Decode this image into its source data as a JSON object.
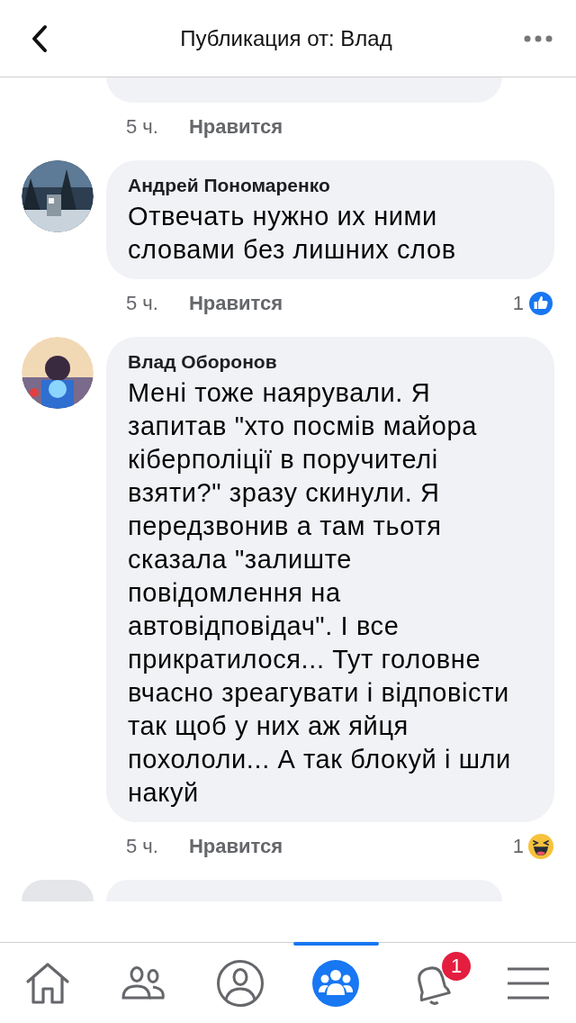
{
  "header": {
    "title": "Публикация от: Влад"
  },
  "comments": [
    {
      "kind": "partial",
      "time": "5 ч.",
      "like_label": "Нравится"
    },
    {
      "kind": "full",
      "author": "Андрей Пономаренко",
      "text": "Отвечать нужно их ними словами без лишних слов",
      "time": "5 ч.",
      "like_label": "Нравится",
      "reaction": {
        "count": "1",
        "kind": "like"
      }
    },
    {
      "kind": "full",
      "author": "Влад Оборонов",
      "text": "Мені тоже наярували. Я запитав \"хто посмів майора кіберполіції в поручителі взяти?\" зразу скинули. Я передзвонив а там тьотя сказала \"залиште повідомлення на автовідповідач\". І все прикратилося... Тут головне вчасно зреагувати і відповісти так щоб у них аж яйця похололи... А так блокуй і шли накуй",
      "time": "5 ч.",
      "like_label": "Нравится",
      "reaction": {
        "count": "1",
        "kind": "haha"
      }
    }
  ],
  "tabs": [
    {
      "kind": "home",
      "selected": false
    },
    {
      "kind": "friends",
      "selected": false
    },
    {
      "kind": "profile",
      "selected": false
    },
    {
      "kind": "groups",
      "selected": true
    },
    {
      "kind": "notifications",
      "selected": false,
      "badge": "1"
    },
    {
      "kind": "menu",
      "selected": false
    }
  ]
}
